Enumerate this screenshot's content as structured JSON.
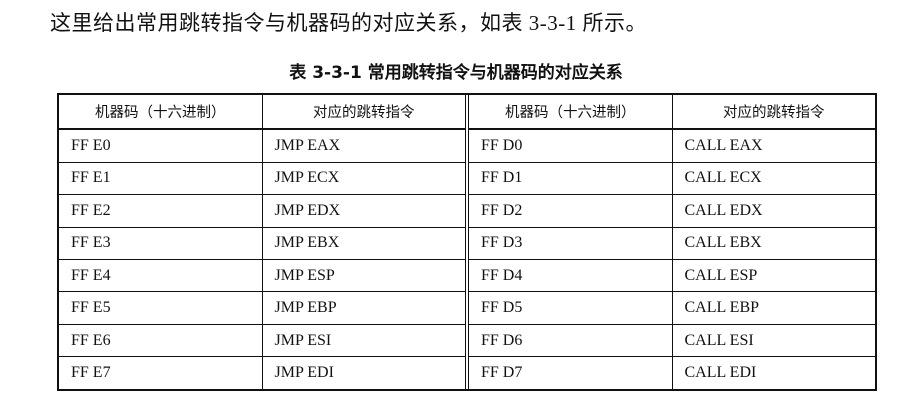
{
  "intro_text": "这里给出常用跳转指令与机器码的对应关系，如表 3-3-1 所示。",
  "table": {
    "caption": "表 3-3-1    常用跳转指令与机器码的对应关系",
    "headers": [
      "机器码（十六进制）",
      "对应的跳转指令",
      "机器码（十六进制）",
      "对应的跳转指令"
    ],
    "left_rows": [
      {
        "code": "FF E0",
        "instr": "JMP EAX"
      },
      {
        "code": "FF E1",
        "instr": "JMP ECX"
      },
      {
        "code": "FF E2",
        "instr": "JMP EDX"
      },
      {
        "code": "FF E3",
        "instr": "JMP EBX"
      },
      {
        "code": "FF E4",
        "instr": "JMP ESP"
      },
      {
        "code": "FF E5",
        "instr": "JMP EBP"
      },
      {
        "code": "FF E6",
        "instr": "JMP ESI"
      },
      {
        "code": "FF E7",
        "instr": "JMP EDI"
      }
    ],
    "right_rows": [
      {
        "code": "FF D0",
        "instr": "CALL EAX"
      },
      {
        "code": "FF D1",
        "instr": "CALL ECX"
      },
      {
        "code": "FF D2",
        "instr": "CALL EDX"
      },
      {
        "code": "FF D3",
        "instr": "CALL EBX"
      },
      {
        "code": "FF D4",
        "instr": "CALL ESP"
      },
      {
        "code": "FF D5",
        "instr": "CALL EBP"
      },
      {
        "code": "FF D6",
        "instr": "CALL ESI"
      },
      {
        "code": "FF D7",
        "instr": "CALL EDI"
      }
    ]
  }
}
